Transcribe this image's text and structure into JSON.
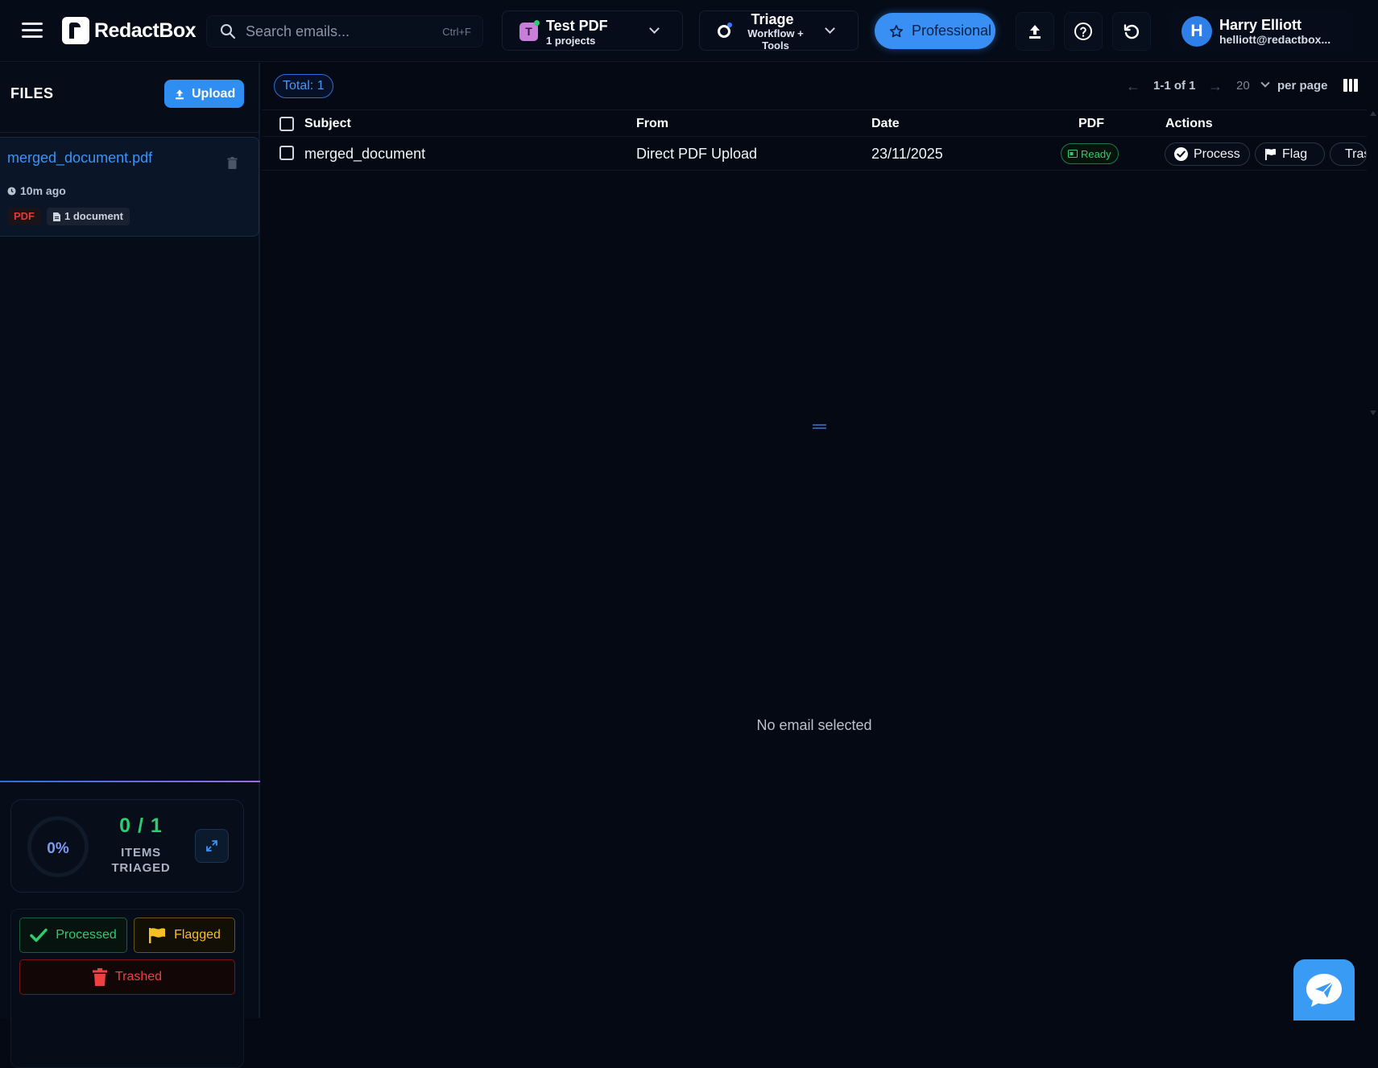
{
  "app": {
    "name": "RedactBox"
  },
  "search": {
    "placeholder": "Search emails...",
    "shortcut": "Ctrl+F"
  },
  "project": {
    "badge": "T",
    "name": "Test PDF",
    "subtitle": "1 projects"
  },
  "mode": {
    "name": "Triage",
    "subtitle": "Workflow + Tools"
  },
  "plan": {
    "label": "Professional"
  },
  "user": {
    "initial": "H",
    "name": "Harry Elliott",
    "email": "helliott@redactbox..."
  },
  "sidebar": {
    "title": "FILES",
    "upload_label": "Upload",
    "files": [
      {
        "name": "merged_document.pdf",
        "time": "10m ago",
        "type": "PDF",
        "docs": "1 document"
      }
    ],
    "progress": {
      "percent": "0%",
      "count": "0 / 1",
      "label_line1": "ITEMS",
      "label_line2": "TRIAGED"
    },
    "status": {
      "processed": "Processed",
      "flagged": "Flagged",
      "trashed": "Trashed"
    }
  },
  "list": {
    "total": "Total: 1",
    "pager": {
      "prev": "←",
      "range": "1-1 of 1",
      "next": "→",
      "page_size": "20",
      "per_page_label": "per page"
    },
    "columns": {
      "subject": "Subject",
      "from": "From",
      "date": "Date",
      "pdf": "PDF",
      "actions": "Actions"
    },
    "rows": [
      {
        "subject": "merged_document",
        "from": "Direct PDF Upload",
        "date": "23/11/2025",
        "pdf_status": "Ready"
      }
    ],
    "actions": {
      "process": "Process",
      "flag": "Flag",
      "trash": "Trash"
    }
  },
  "detail": {
    "empty_message": "No email selected"
  },
  "colors": {
    "accent": "#3a8ff5",
    "success": "#2ecc71",
    "warning": "#f5c024",
    "danger": "#f04040",
    "background": "#040914"
  },
  "icons": [
    "menu-icon",
    "search-icon",
    "chevron-down-icon",
    "triage-icon",
    "star-icon",
    "upload-icon",
    "help-icon",
    "refresh-icon",
    "trash-icon",
    "clock-icon",
    "document-icon",
    "expand-icon",
    "check-icon",
    "flag-icon",
    "columns-icon",
    "chat-send-icon"
  ]
}
